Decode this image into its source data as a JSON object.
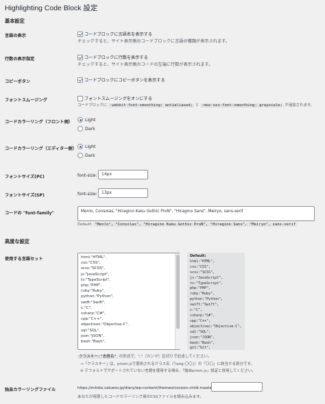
{
  "page_title": "Highlighting Code Block 設定",
  "basic": {
    "heading": "基本設定",
    "show_lang": {
      "label": "言語の表示",
      "checkbox": "コードブロックに言語名を表示する",
      "desc": "チェックすると、サイト表示側のコードブロックに言語の種類が表示されます。"
    },
    "show_linenum": {
      "label": "行数の表示指定",
      "checkbox": "コードブロックに行数を表示する",
      "desc": "チェックすると、サイト表示側のコードの左端に行数が表示されます。"
    },
    "copy_btn": {
      "label": "コピーボタン",
      "checkbox": "コードブロックにコピーボタンを表示する"
    },
    "font_smoothing": {
      "label": "フォントスムージング",
      "checkbox": "フォントスムージングをオンにする",
      "desc_prefix": "コードブロックに",
      "code1": "-webkit-font-smoothing: antialiased;",
      "desc_mid": "と",
      "code2": "-moz-osx-font-smoothing: grayscale;",
      "desc_suffix": "が追加されます。"
    },
    "coloring_front": {
      "label": "コードカラーリング（フロント側）",
      "options": [
        "Light",
        "Dark"
      ],
      "selected": "Light"
    },
    "coloring_editor": {
      "label": "コードカラーリング（エディター側）",
      "options": [
        "Light",
        "Dark"
      ],
      "selected": "Light"
    },
    "font_size_pc": {
      "label": "フォントサイズ(PC)",
      "prefix": "font-size:",
      "value": "14px"
    },
    "font_size_sp": {
      "label": "フォントサイズ(SP)",
      "prefix": "font-size:",
      "value": "13px"
    },
    "font_family": {
      "label": "コードの \"font-family\"",
      "value": "Menlo, Consolas, \"Hiragino Kaku Gothic ProN\", \"Hiragino Sans\", Meiryo, sans-serif",
      "default_label": "Default:",
      "default_value": "\"Menlo\", \"Consolas\", \"Hiragino Kaku Gothic ProN\", \"Hiragino Sans\", \"Meiryo\", sans-serif"
    }
  },
  "advanced": {
    "heading": "高度な設定",
    "lang_set": {
      "label": "使用する言語セット",
      "textarea_lines": [
        "html:\"HTML\",",
        "css:\"CSS\",",
        "scss:\"SCSS\",",
        "js:\"JavaScript\",",
        "ts:\"TypeScript\",",
        "php:\"PHP\",",
        "ruby:\"Ruby\",",
        "python:\"Python\",",
        "swift:\"Swift\",",
        "c:\"C\",",
        "csharp:\"C#\",",
        "cpp:\"C++\",",
        "objectivec:\"Objective-C\",",
        "sql:\"SQL\",",
        "json:\"JSON\",",
        "bash:\"Bash\","
      ],
      "default_title": "Default:",
      "default_lines": [
        "html:\"HTML\",",
        "css:\"CSS\",",
        "scss:\"SCSS\",",
        "js:\"JavaScript\",",
        "ts:\"TypeScript\",",
        "php:\"PHP\",",
        "ruby:\"Ruby\",",
        "python:\"Python\",",
        "swift:\"Swift\",",
        "c:\"C\",",
        "csharp:\"C#\",",
        "cpp:\"C++\",",
        "objectivec:\"Objective-C\",",
        "sql:\"SQL\",",
        "json:\"JSON\",",
        "bash:\"Bash\",",
        "git:\"Git\","
      ],
      "note1_code": "クラスキー:\"言語名\"",
      "note1_text": "の形式で、\",\"（カンマ）区切りで記述してください。",
      "note2": "→「クラスキー」は、prism.jsで使用されるクラス名（「lang-〇〇」）の「〇〇」に該当する部分です。",
      "note3": "※ デフォルトでサポートされていない言語を使用する場合、「独自prism.js」設定と併用してください。"
    },
    "custom_coloring": {
      "label": "独自カラーリングファイル",
      "url_prefix": "https://mkdia.valuesv.jp/diary/wp-content/themes/cocoon-child-master/",
      "input_value": "",
      "desc": "あなたが用意したコードカラーリング用のCSSファイルを読み込みます。"
    }
  },
  "colors": {
    "background": "#f0f0f1",
    "accent": "#2271b1",
    "text": "#1d2327"
  }
}
